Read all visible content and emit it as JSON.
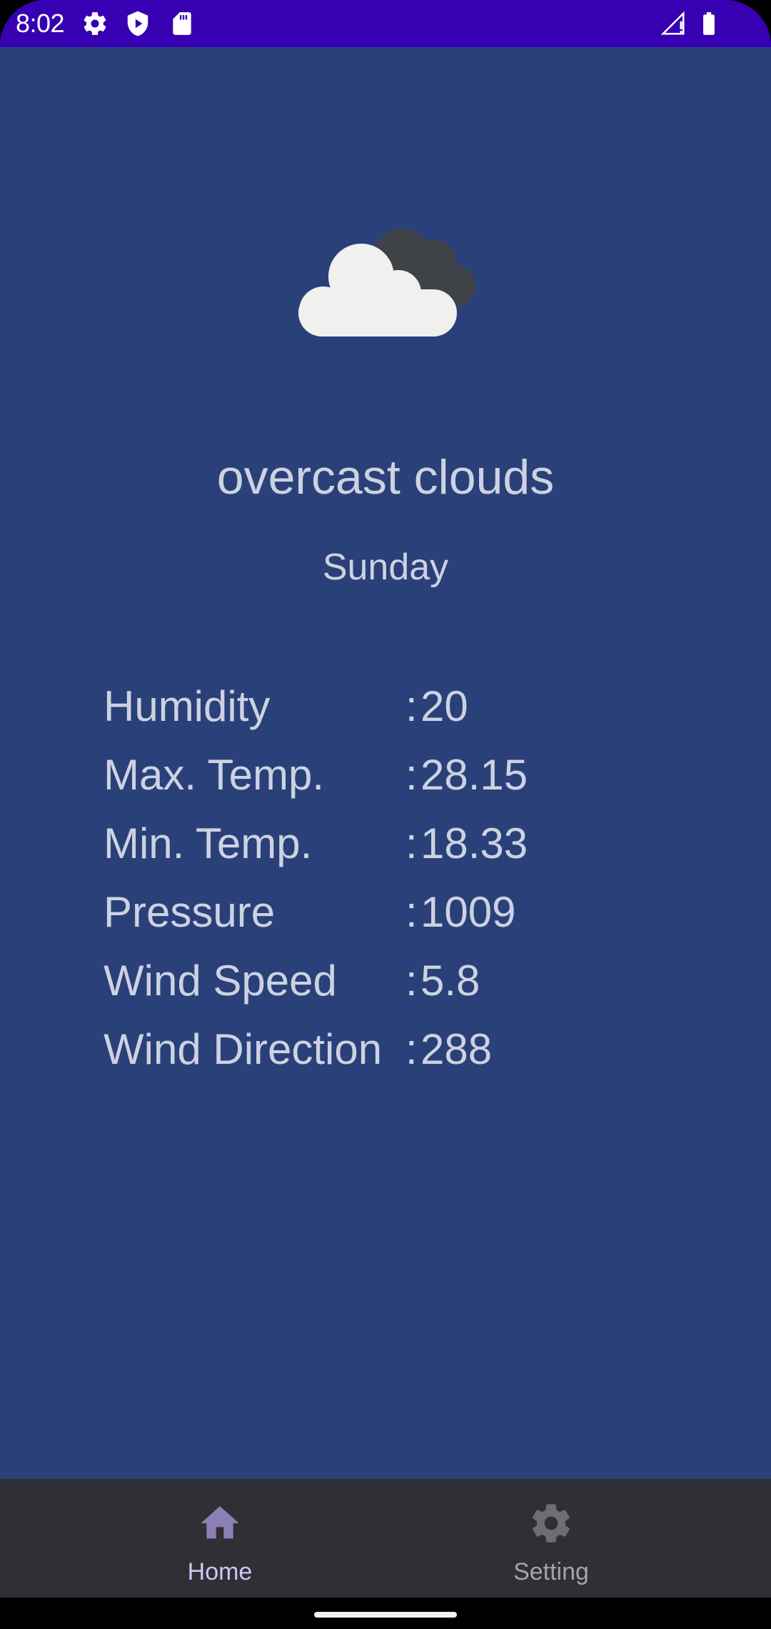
{
  "status_bar": {
    "time": "8:02",
    "icons": [
      "gear-icon",
      "shield-play-icon",
      "sd-card-icon",
      "signal-alert-icon",
      "battery-icon"
    ]
  },
  "weather": {
    "icon": "overcast-clouds-icon",
    "description": "overcast clouds",
    "day": "Sunday"
  },
  "stats": [
    {
      "label": "Humidity",
      "colon": ":",
      "value": "20"
    },
    {
      "label": "Max. Temp.",
      "colon": ":",
      "value": "28.15"
    },
    {
      "label": "Min. Temp.",
      "colon": ":",
      "value": "18.33"
    },
    {
      "label": "Pressure",
      "colon": ":",
      "value": "1009"
    },
    {
      "label": "Wind Speed",
      "colon": ":",
      "value": "5.8"
    },
    {
      "label": "Wind Direction",
      "colon": ":",
      "value": "288"
    }
  ],
  "bottom_nav": {
    "items": [
      {
        "label": "Home",
        "icon": "home-icon",
        "selected": true
      },
      {
        "label": "Setting",
        "icon": "settings-gear-icon",
        "selected": false
      }
    ]
  },
  "colors": {
    "status_bar": "#3700b3",
    "background": "#2a4078",
    "text": "#cdd2e2",
    "nav_background": "#302f35",
    "nav_selected": "#d3c4f4",
    "nav_unselected": "#a4a4aa"
  }
}
